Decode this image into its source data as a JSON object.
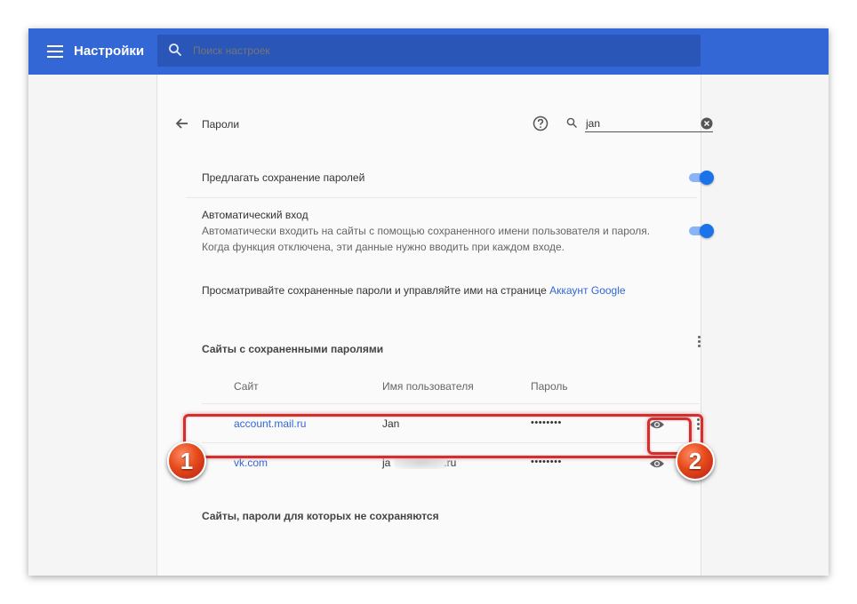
{
  "header": {
    "app_title": "Настройки",
    "search_placeholder": "Поиск настроек"
  },
  "passwords_page": {
    "title": "Пароли",
    "filter_value": "jan",
    "offer_to_save_label": "Предлагать сохранение паролей",
    "offer_to_save_enabled": true,
    "auto_signin_title": "Автоматический вход",
    "auto_signin_desc_line1": "Автоматически входить на сайты с помощью сохраненного имени пользователя и пароля.",
    "auto_signin_desc_line2": "Когда функция отключена, эти данные нужно вводить при каждом входе.",
    "auto_signin_enabled": true,
    "manage_text": "Просматривайте сохраненные пароли и управляйте ими на странице",
    "manage_link": "Аккаунт Google",
    "saved_section_title": "Сайты с сохраненными паролями",
    "columns": {
      "site": "Сайт",
      "username": "Имя пользователя",
      "password": "Пароль"
    },
    "saved_rows": [
      {
        "site": "account.mail.ru",
        "username": "Jan",
        "password": "••••••••"
      },
      {
        "site": "vk.com",
        "username_prefix": "ja",
        "username_suffix": ".ru",
        "password": "••••••••"
      }
    ],
    "never_saved_title": "Сайты, пароли для которых не сохраняются"
  },
  "annotations": {
    "badge_1": "1",
    "badge_2": "2",
    "highlight_color": "#d32f2f"
  },
  "colors": {
    "topbar": "#3367d6",
    "link": "#3367d6",
    "toggle_on": "#1a73e8"
  },
  "icons": [
    "menu-icon",
    "search-icon",
    "back-arrow-icon",
    "help-icon",
    "clear-icon",
    "eye-icon",
    "more-vert-icon"
  ]
}
